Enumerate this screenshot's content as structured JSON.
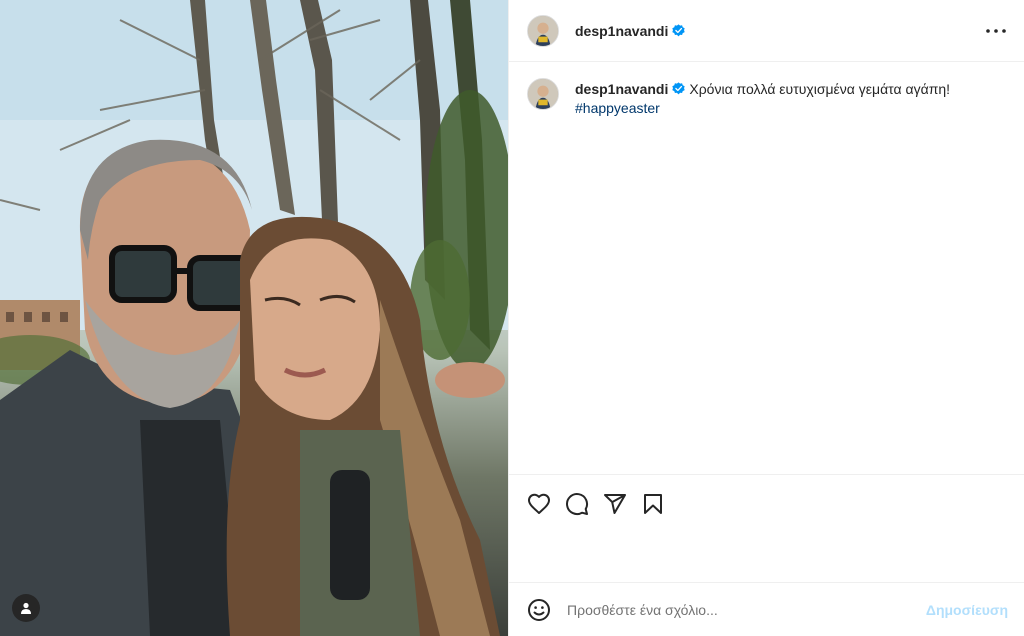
{
  "post": {
    "author": {
      "username": "desp1navandi",
      "verified": true
    },
    "caption": {
      "text": "Χρόνια πολλά ευτυχισμένα γεμάτα αγάπη!",
      "hashtag": "#happyeaster"
    },
    "comment_box": {
      "placeholder": "Προσθέστε ένα σχόλιο...",
      "post_label": "Δημοσίευση"
    }
  },
  "icons": {
    "verified": "verified-badge-icon",
    "more": "more-options-icon",
    "like": "heart-icon",
    "comment": "comment-bubble-icon",
    "share": "paper-plane-icon",
    "save": "bookmark-icon",
    "emoji": "smiley-icon",
    "user_tag": "person-icon"
  },
  "colors": {
    "verified": "#0095f6",
    "hashtag": "#00376b",
    "post_button_disabled": "#b2dffc",
    "text": "#262626"
  }
}
